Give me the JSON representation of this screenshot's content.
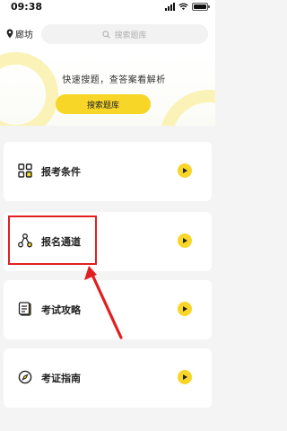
{
  "status_bar": {
    "time": "09:38"
  },
  "header": {
    "location": "廊坊",
    "search_placeholder": "搜索题库"
  },
  "banner": {
    "text": "快速搜题，查答案看解析",
    "button_label": "搜索题库"
  },
  "cards": [
    {
      "label": "报考条件",
      "icon": "grid-icon"
    },
    {
      "label": "报名通道",
      "icon": "share-nodes-icon"
    },
    {
      "label": "考试攻略",
      "icon": "document-icon"
    },
    {
      "label": "考证指南",
      "icon": "compass-icon"
    }
  ],
  "colors": {
    "accent": "#f7d628",
    "annotation": "#e02020",
    "background": "#f4f4f4"
  }
}
